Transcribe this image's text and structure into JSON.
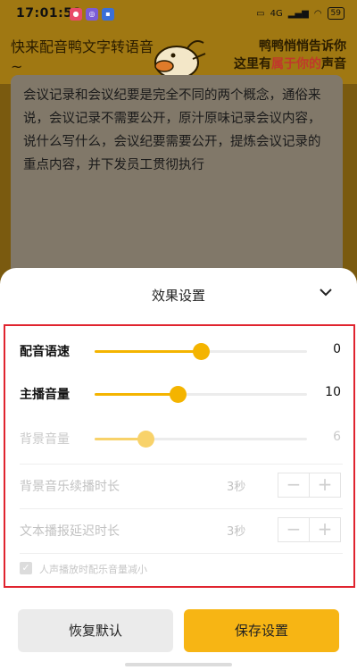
{
  "status_bar": {
    "time": "17:01:58",
    "app_icons": [
      "app-badge-icon",
      "app-circle-icon",
      "app-blue-icon"
    ],
    "network": "4G",
    "battery": "59"
  },
  "header": {
    "title": "快来配音鸭文字转语音~",
    "banner_line1": "鸭鸭悄悄告诉你",
    "banner_line2_prefix": "这里有",
    "banner_line2_highlight": "属于你的",
    "banner_line2_suffix": "声音"
  },
  "editor": {
    "text": "会议记录和会议纪要是完全不同的两个概念，通俗来说，会议记录不需要公开，原汁原味记录会议内容，说什么写什么，会议纪要需要公开，提炼会议记录的重点内容，并下发员工贯彻执行"
  },
  "sheet": {
    "title": "效果设置",
    "speed": {
      "label": "配音语速",
      "value": "0",
      "level": 0.5
    },
    "host_volume": {
      "label": "主播音量",
      "value": "10",
      "level": 0.39
    },
    "bg_volume": {
      "label": "背景音量",
      "value": "6",
      "level": 0.24
    },
    "bg_duration": {
      "label": "背景音乐续播时长",
      "value": "3秒",
      "minus": "−",
      "plus": "+"
    },
    "delay": {
      "label": "文本播报延迟时长",
      "value": "3秒",
      "minus": "−",
      "plus": "+"
    },
    "duck_checkbox": {
      "label": "人声播放时配乐音量减小",
      "checked": true
    }
  },
  "buttons": {
    "reset": "恢复默认",
    "save": "保存设置"
  },
  "colors": {
    "accent": "#f4b400",
    "highlight_border": "#e0242f"
  }
}
